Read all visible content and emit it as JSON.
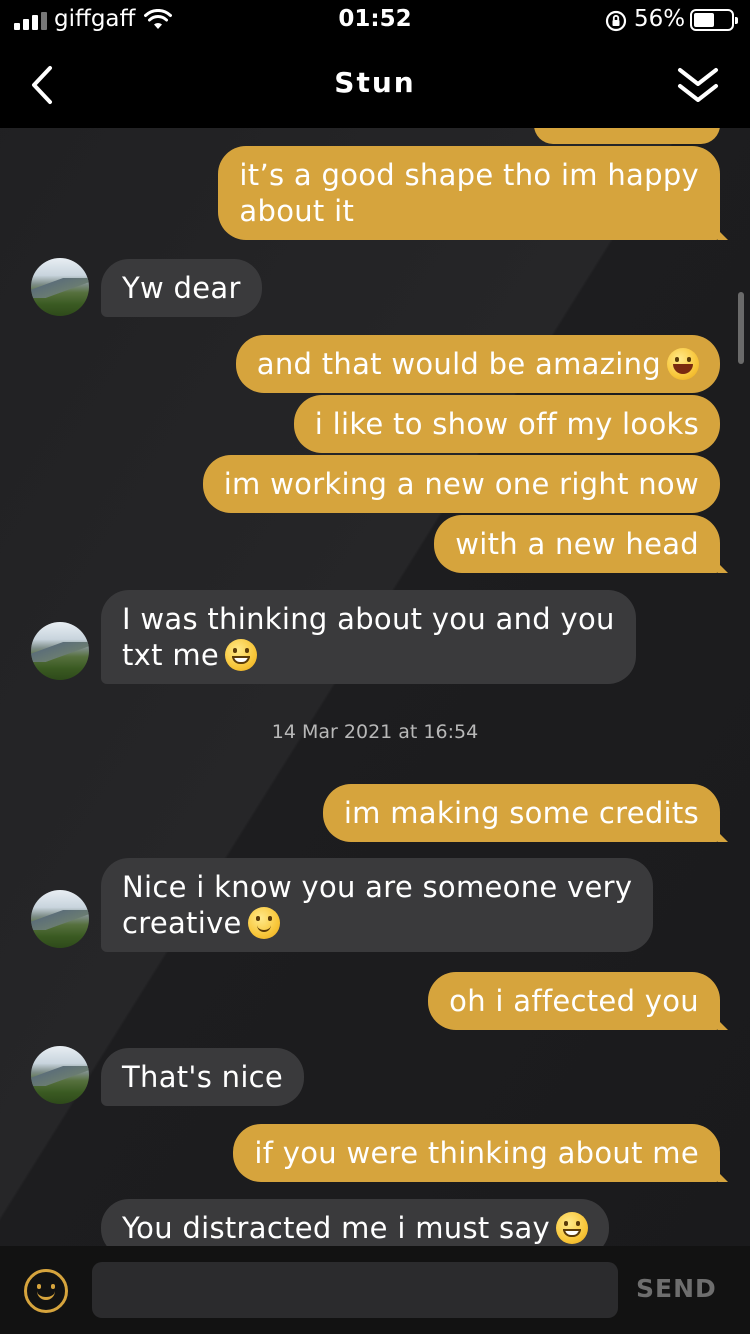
{
  "status_bar": {
    "carrier": "giffgaff",
    "time": "01:52",
    "battery_percent": "56%",
    "battery_level": 0.56
  },
  "header": {
    "title": "Stun",
    "back_icon": "chevron-left-icon",
    "collapse_icon": "double-chevron-down-icon"
  },
  "messages": [
    {
      "side": "out",
      "lines": [
        "it’s a good shape tho im happy",
        "about it"
      ]
    },
    {
      "side": "in",
      "lines": [
        "Yw dear"
      ]
    },
    {
      "side": "out",
      "lines": [
        "and that would be amazing"
      ],
      "emoji": "laughing-tears-emoji"
    },
    {
      "side": "out",
      "lines": [
        "i like to show off my looks"
      ]
    },
    {
      "side": "out",
      "lines": [
        "im working a new one right now"
      ]
    },
    {
      "side": "out",
      "lines": [
        "with a new head"
      ]
    },
    {
      "side": "in",
      "lines": [
        "I was thinking about you and you",
        "txt me"
      ],
      "emoji": "grinning-emoji"
    },
    {
      "side": "out",
      "lines": [
        "im making some credits"
      ]
    },
    {
      "side": "in",
      "lines": [
        "Nice i know you are someone very",
        "creative"
      ],
      "emoji": "smiling-emoji"
    },
    {
      "side": "out",
      "lines": [
        "oh i affected you"
      ]
    },
    {
      "side": "in",
      "lines": [
        "That's nice"
      ]
    },
    {
      "side": "out",
      "lines": [
        "if you were thinking about me"
      ]
    },
    {
      "side": "in",
      "lines": [
        "You distracted me i must say"
      ],
      "emoji": "grinning-emoji"
    }
  ],
  "timestamp": "14 Mar 2021 at 16:54",
  "composer": {
    "placeholder": "",
    "value": "",
    "send_label": "SEND"
  },
  "colors": {
    "outgoing_bubble": "#d6a43d",
    "incoming_bubble": "#3a3a3c",
    "accent": "#d6a43d",
    "background": "#1c1c1e"
  }
}
